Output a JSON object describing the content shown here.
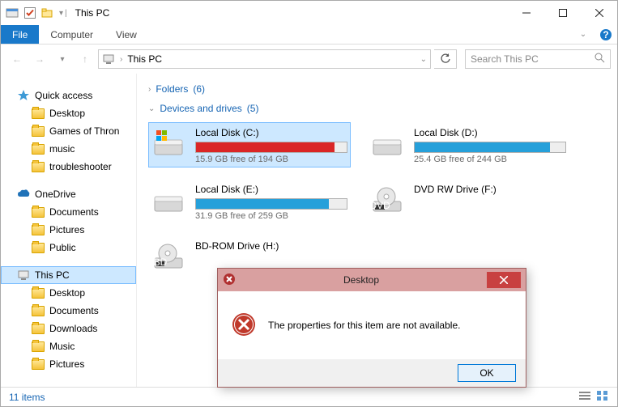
{
  "titlebar": {
    "title": "This PC"
  },
  "ribbon": {
    "file": "File",
    "tabs": [
      "Computer",
      "View"
    ]
  },
  "nav": {
    "address": "This PC",
    "search_placeholder": "Search This PC"
  },
  "tree": {
    "quick": {
      "label": "Quick access",
      "items": [
        "Desktop",
        "Games of Thron",
        "music",
        "troubleshooter"
      ]
    },
    "onedrive": {
      "label": "OneDrive",
      "items": [
        "Documents",
        "Pictures",
        "Public"
      ]
    },
    "thispc": {
      "label": "This PC",
      "items": [
        "Desktop",
        "Documents",
        "Downloads",
        "Music",
        "Pictures"
      ]
    }
  },
  "groups": {
    "folders": {
      "label": "Folders",
      "count": "(6)"
    },
    "drives": {
      "label": "Devices and drives",
      "count": "(5)"
    }
  },
  "drives": [
    {
      "name": "Local Disk (C:)",
      "free": "15.9 GB free of 194 GB",
      "fill_pct": 92,
      "color": "#da2626",
      "icon": "win-drive",
      "selected": true
    },
    {
      "name": "Local Disk (D:)",
      "free": "25.4 GB free of 244 GB",
      "fill_pct": 90,
      "color": "#26a0da",
      "icon": "drive",
      "selected": false
    },
    {
      "name": "Local Disk (E:)",
      "free": "31.9 GB free of 259 GB",
      "fill_pct": 88,
      "color": "#26a0da",
      "icon": "drive",
      "selected": false
    },
    {
      "name": "DVD RW Drive (F:)",
      "free": "",
      "fill_pct": 0,
      "color": "",
      "icon": "dvd",
      "selected": false
    },
    {
      "name": "BD-ROM Drive (H:)",
      "free": "",
      "fill_pct": 0,
      "color": "",
      "icon": "bd",
      "selected": false
    }
  ],
  "status": {
    "text": "11 items"
  },
  "dialog": {
    "title": "Desktop",
    "message": "The properties for this item are not available.",
    "ok": "OK"
  }
}
